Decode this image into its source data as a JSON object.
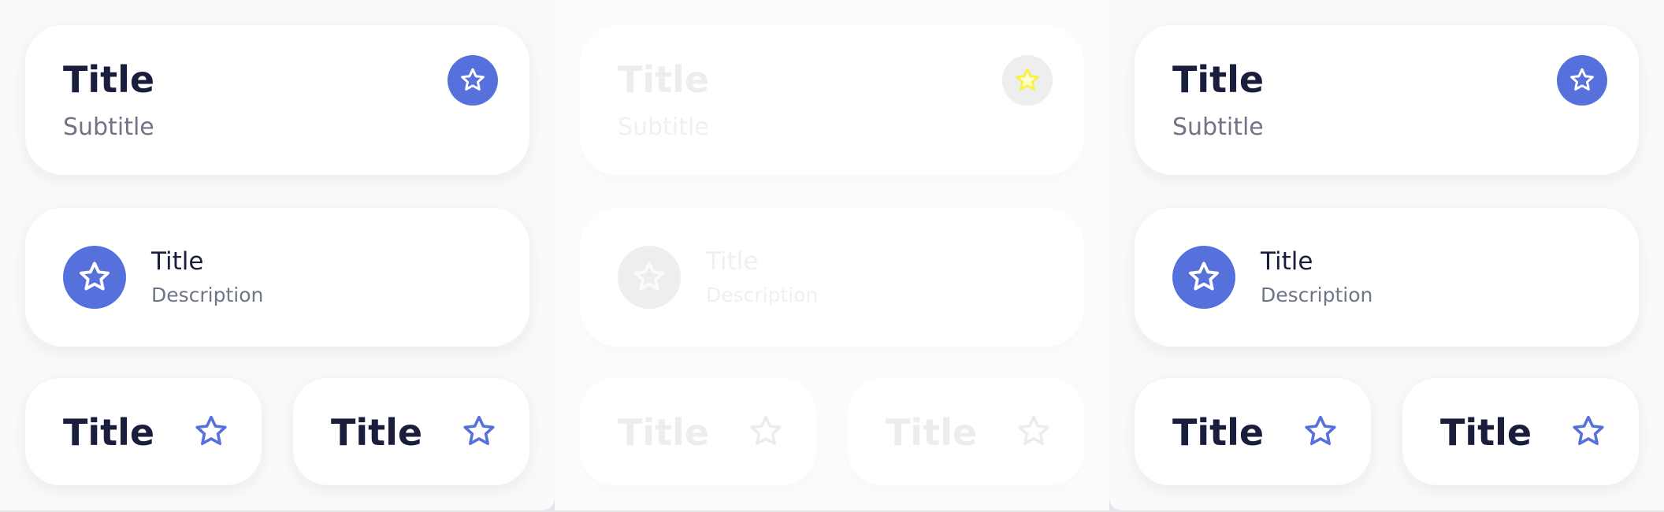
{
  "colors": {
    "accent": "#5670dc",
    "title_text": "#1b1d3d",
    "secondary_text": "#707487",
    "disabled_fill": "#eeeeef",
    "disabled_text": "#ededef",
    "highlight_star": "#f7f14a"
  },
  "panels": [
    {
      "state": "default",
      "header_card": {
        "title": "Title",
        "subtitle": "Subtitle",
        "icon": "star-icon"
      },
      "list_card": {
        "title": "Title",
        "description": "Description",
        "icon": "star-icon"
      },
      "small_cards": [
        {
          "title": "Title",
          "icon": "star-outline-icon"
        },
        {
          "title": "Title",
          "icon": "star-outline-icon"
        }
      ]
    },
    {
      "state": "disabled",
      "header_card": {
        "title": "Title",
        "subtitle": "Subtitle",
        "icon": "star-icon"
      },
      "list_card": {
        "title": "Title",
        "description": "Description",
        "icon": "star-icon"
      },
      "small_cards": [
        {
          "title": "Title",
          "icon": "star-outline-icon"
        },
        {
          "title": "Title",
          "icon": "star-outline-icon"
        }
      ]
    },
    {
      "state": "default",
      "header_card": {
        "title": "Title",
        "subtitle": "Subtitle",
        "icon": "star-icon"
      },
      "list_card": {
        "title": "Title",
        "description": "Description",
        "icon": "star-icon"
      },
      "small_cards": [
        {
          "title": "Title",
          "icon": "star-outline-icon"
        },
        {
          "title": "Title",
          "icon": "star-outline-icon"
        }
      ]
    }
  ]
}
